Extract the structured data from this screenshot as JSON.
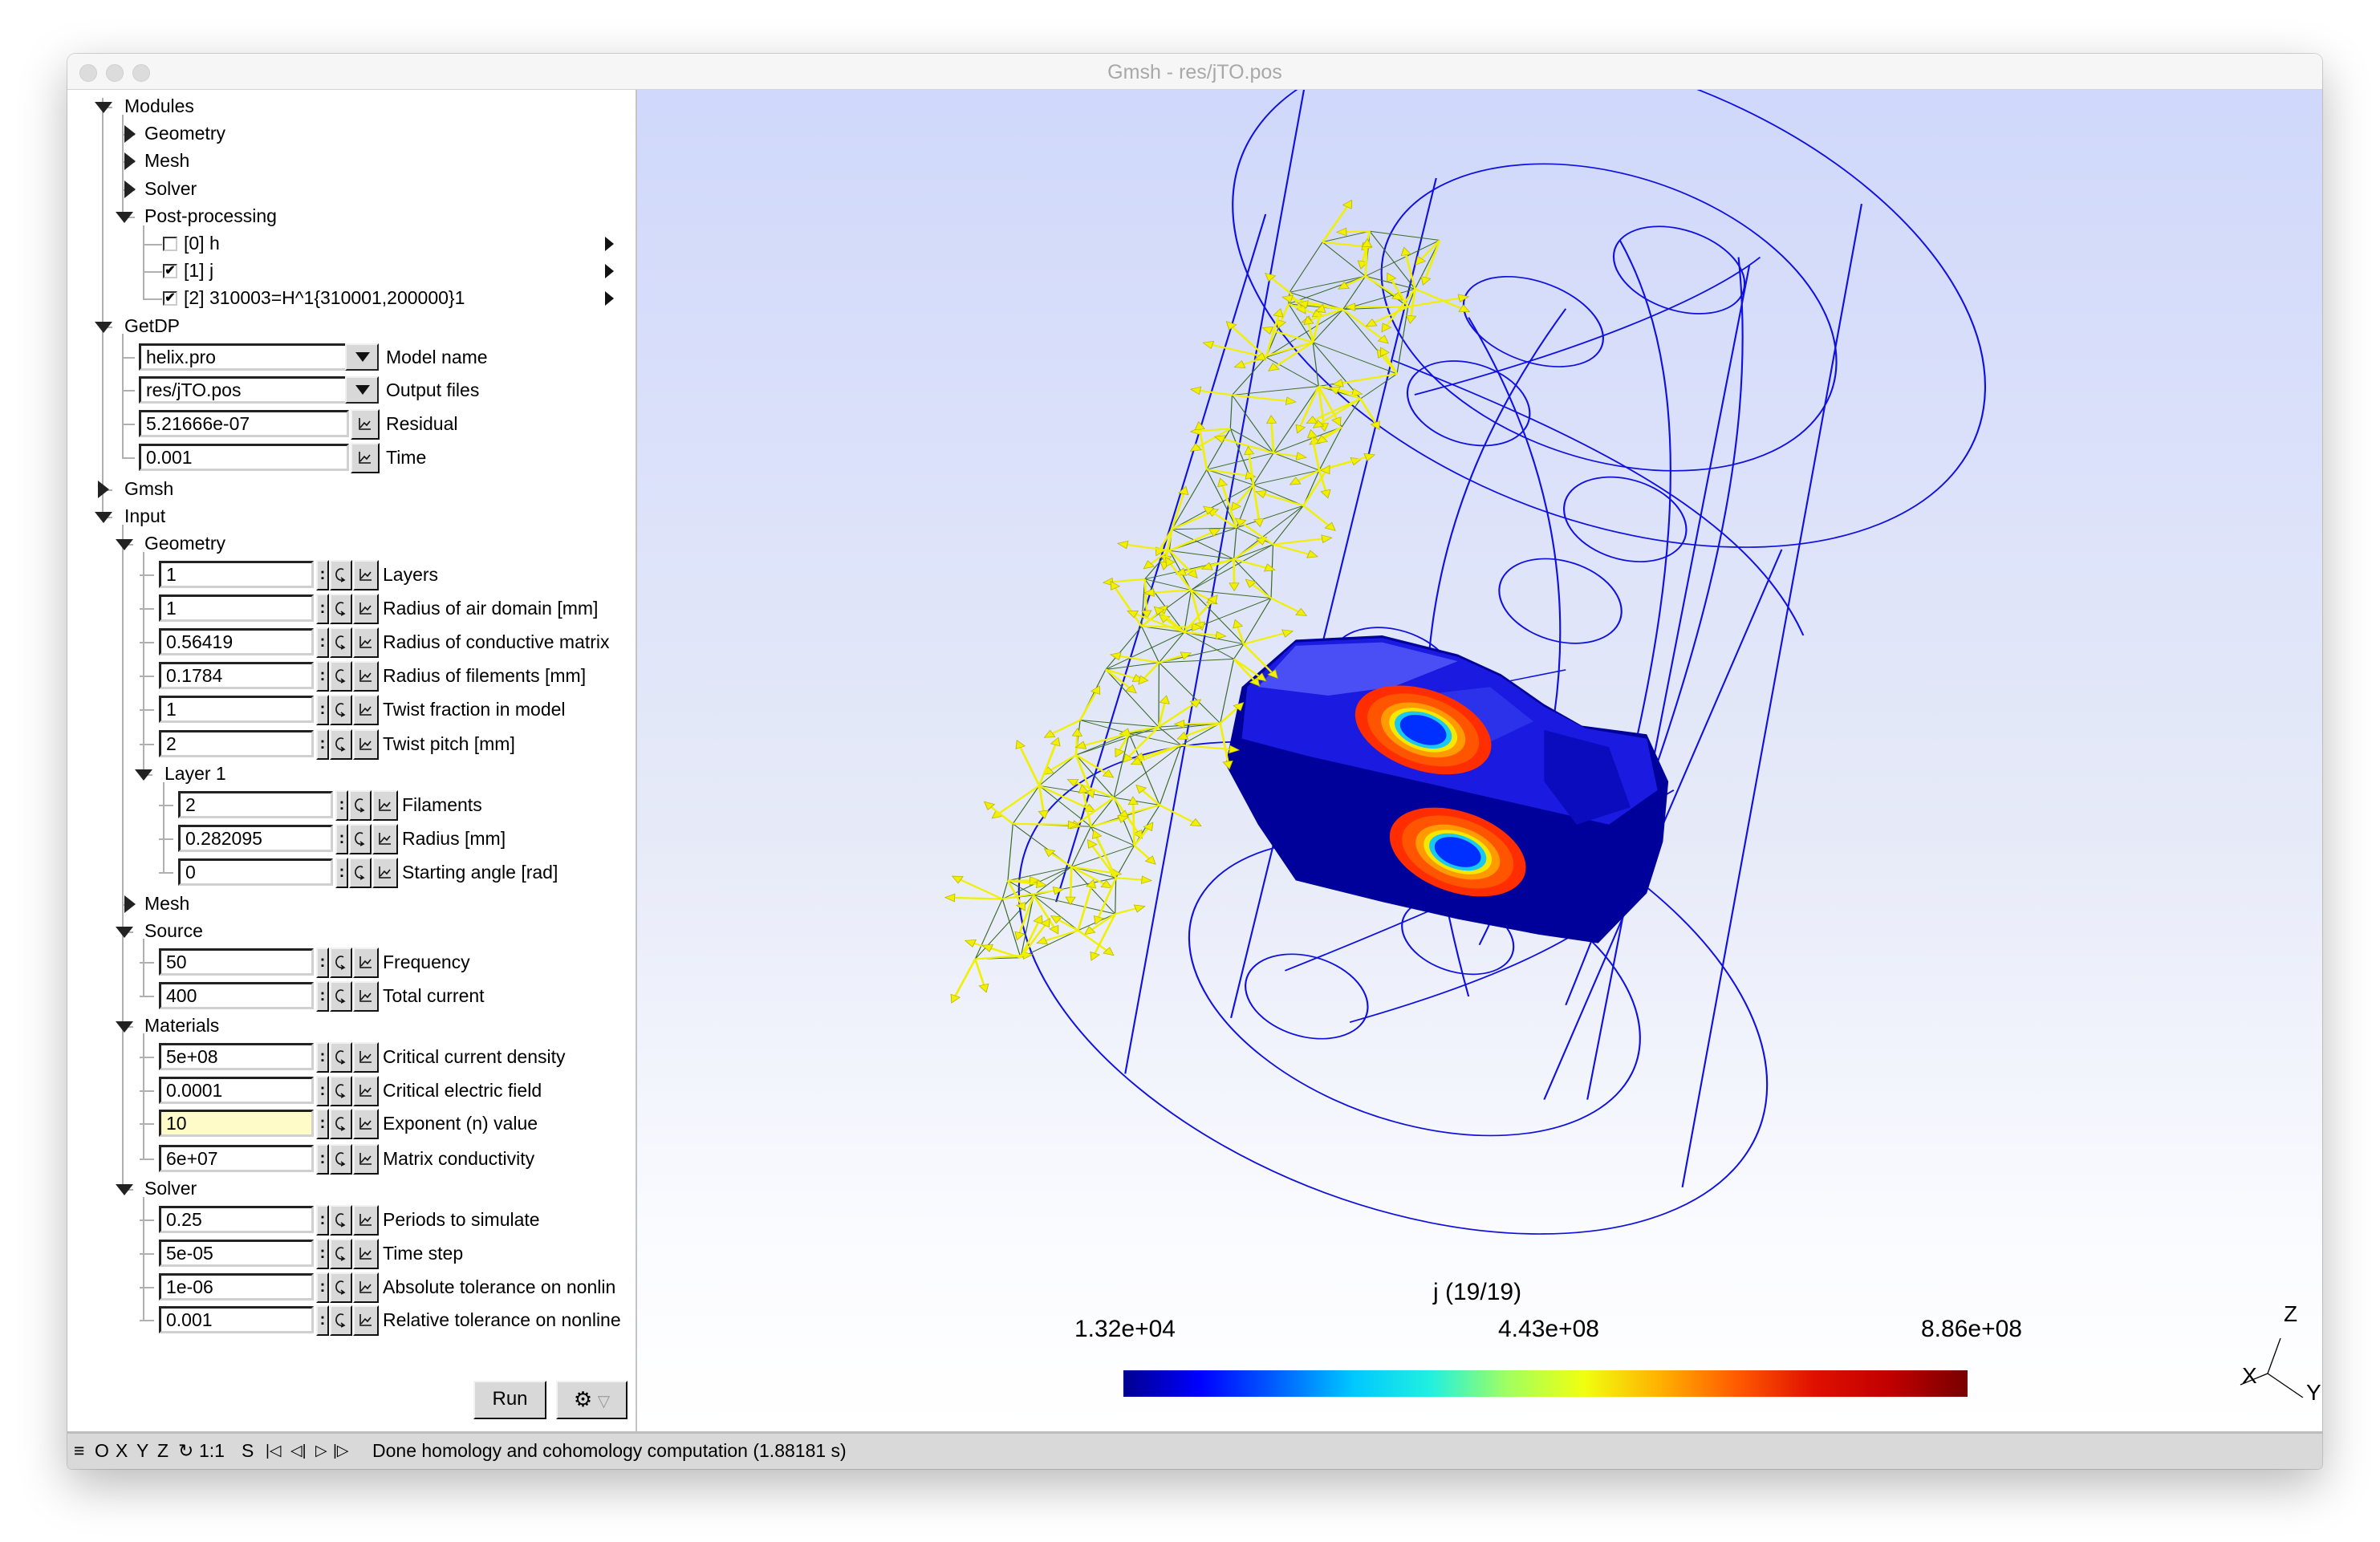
{
  "window": {
    "title": "Gmsh - res/jTO.pos"
  },
  "tree": {
    "modules": {
      "label": "Modules",
      "children": [
        {
          "label": "Geometry",
          "expanded": false
        },
        {
          "label": "Mesh",
          "expanded": false
        },
        {
          "label": "Solver",
          "expanded": false
        },
        {
          "label": "Post-processing",
          "expanded": true
        }
      ],
      "views": [
        {
          "label": "[0] h",
          "checked": false
        },
        {
          "label": "[1] j",
          "checked": true
        },
        {
          "label": "[2] 310003=H^1{310001,200000}1",
          "checked": true
        }
      ]
    },
    "getdp": {
      "label": "GetDP",
      "model_name": {
        "value": "helix.pro",
        "label": "Model name"
      },
      "output_files": {
        "value": "res/jTO.pos",
        "label": "Output files"
      },
      "residual": {
        "value": "5.21666e-07",
        "label": "Residual"
      },
      "time": {
        "value": "0.001",
        "label": "Time"
      }
    },
    "gmsh": {
      "label": "Gmsh"
    },
    "input": {
      "label": "Input",
      "geometry": {
        "label": "Geometry",
        "params": [
          {
            "value": "1",
            "label": "Layers"
          },
          {
            "value": "1",
            "label": "Radius of air domain [mm]"
          },
          {
            "value": "0.56419",
            "label": "Radius of conductive matrix"
          },
          {
            "value": "0.1784",
            "label": "Radius of filements [mm]"
          },
          {
            "value": "1",
            "label": "Twist fraction in model"
          },
          {
            "value": "2",
            "label": "Twist pitch [mm]"
          }
        ],
        "layer1": {
          "label": "Layer 1",
          "params": [
            {
              "value": "2",
              "label": "Filaments"
            },
            {
              "value": "0.282095",
              "label": "Radius [mm]"
            },
            {
              "value": "0",
              "label": "Starting angle [rad]"
            }
          ]
        }
      },
      "mesh": {
        "label": "Mesh"
      },
      "source": {
        "label": "Source",
        "params": [
          {
            "value": "50",
            "label": "Frequency"
          },
          {
            "value": "400",
            "label": "Total current"
          }
        ]
      },
      "materials": {
        "label": "Materials",
        "params": [
          {
            "value": "5e+08",
            "label": "Critical current density"
          },
          {
            "value": "0.0001",
            "label": "Critical electric field"
          },
          {
            "value": "10",
            "label": "Exponent (n) value",
            "highlighted": true
          },
          {
            "value": "6e+07",
            "label": "Matrix conductivity"
          }
        ]
      },
      "solver": {
        "label": "Solver",
        "params": [
          {
            "value": "0.25",
            "label": "Periods to simulate"
          },
          {
            "value": "5e-05",
            "label": "Time step"
          },
          {
            "value": "1e-06",
            "label": "Absolute tolerance on nonlin"
          },
          {
            "value": "0.001",
            "label": "Relative tolerance on nonline"
          }
        ]
      }
    },
    "param_buttons": {
      "range": ":",
      "loop": "↻",
      "graph": "graph-icon"
    }
  },
  "actions": {
    "run_label": "Run",
    "gear_icon": "gear-icon",
    "gear_dropdown": "▽"
  },
  "statusbar": {
    "items": [
      "≡",
      "O",
      "X",
      "Y",
      "Z",
      "↻",
      "1:1",
      "S"
    ],
    "playback": [
      "|◁",
      "◁|",
      "▷",
      "|▷"
    ],
    "message": "Done homology and cohomology computation (1.88181 s)"
  },
  "viewport": {
    "colorbar": {
      "title": "j (19/19)",
      "min_label": "1.32e+04",
      "mid_label": "4.43e+08",
      "max_label": "8.86e+08",
      "colors": [
        "#00008f",
        "#0000ff",
        "#0060ff",
        "#00c8ff",
        "#20f0e0",
        "#a0ff60",
        "#f0ff10",
        "#ffb000",
        "#ff5a00",
        "#e01000",
        "#c00000",
        "#780000"
      ]
    },
    "axes": {
      "x": "X",
      "y": "Y",
      "z": "Z"
    },
    "wire_color": "#1010e0",
    "arrow_color": "#f0f000",
    "mesh_color": "#3a6b2a"
  }
}
